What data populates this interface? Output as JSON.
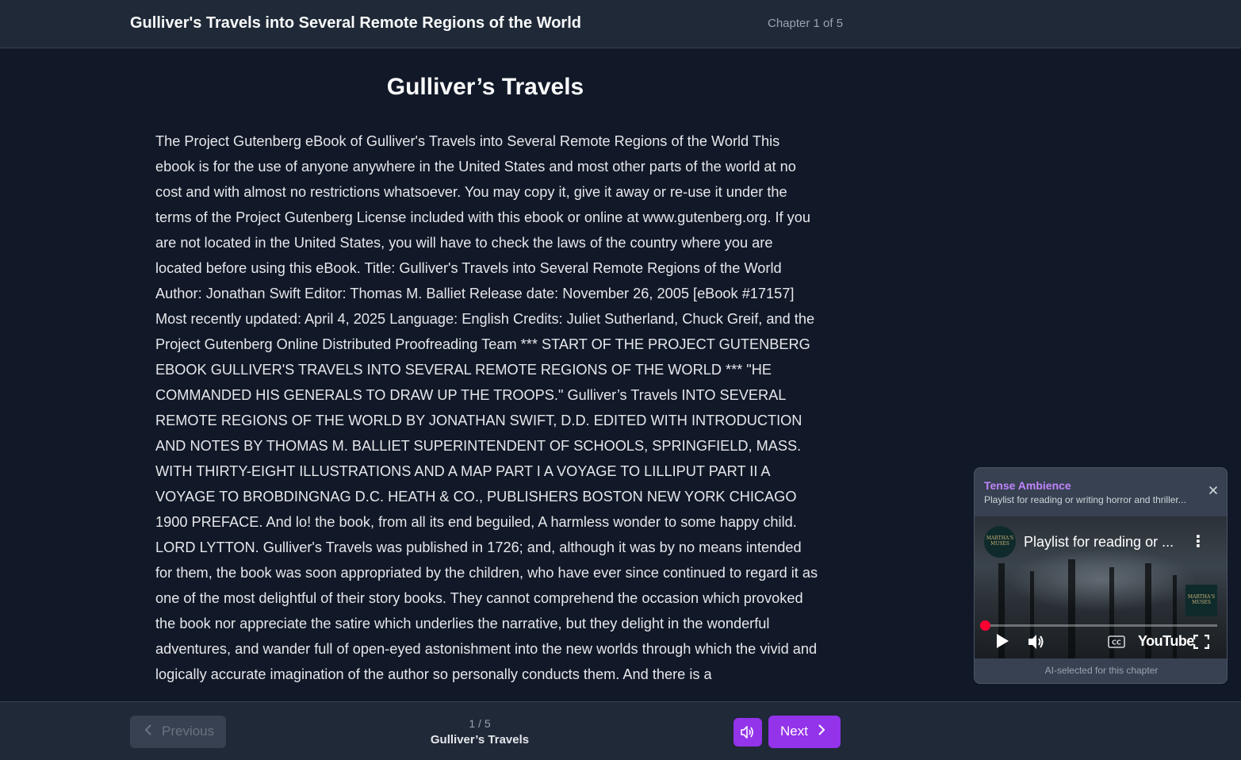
{
  "header": {
    "book_title": "Gulliver's Travels into Several Remote Regions of the World",
    "chapter_indicator": "Chapter 1 of 5"
  },
  "chapter": {
    "title": "Gulliver’s Travels",
    "body": "The Project Gutenberg eBook of Gulliver's Travels into Several Remote Regions of the World This ebook is for the use of anyone anywhere in the United States and most other parts of the world at no cost and with almost no restrictions whatsoever. You may copy it, give it away or re-use it under the terms of the Project Gutenberg License included with this ebook or online at www.gutenberg.org. If you are not located in the United States, you will have to check the laws of the country where you are located before using this eBook. Title: Gulliver's Travels into Several Remote Regions of the World Author: Jonathan Swift Editor: Thomas M. Balliet Release date: November 26, 2005 [eBook #17157] Most recently updated: April 4, 2025 Language: English Credits: Juliet Sutherland, Chuck Greif, and the Project Gutenberg Online Distributed Proofreading Team *** START OF THE PROJECT GUTENBERG EBOOK GULLIVER'S TRAVELS INTO SEVERAL REMOTE REGIONS OF THE WORLD *** \"HE COMMANDED HIS GENERALS TO DRAW UP THE TROOPS.\" Gulliver’s Travels INTO SEVERAL REMOTE REGIONS OF THE WORLD BY JONATHAN SWIFT, D.D. EDITED WITH INTRODUCTION AND NOTES BY THOMAS M. BALLIET SUPERINTENDENT OF SCHOOLS, SPRINGFIELD, MASS. WITH THIRTY-EIGHT ILLUSTRATIONS AND A MAP PART I A VOYAGE TO LILLIPUT PART II A VOYAGE TO BROBDINGNAG D.C. HEATH & CO., PUBLISHERS BOSTON NEW YORK CHICAGO 1900 PREFACE. And lo! the book, from all its end beguiled, A harmless wonder to some happy child. LORD LYTTON. Gulliver's Travels was published in 1726; and, although it was by no means intended for them, the book was soon appropriated by the children, who have ever since continued to regard it as one of the most delightful of their story books. They cannot comprehend the occasion which provoked the book nor appreciate the satire which underlies the narrative, but they delight in the wonderful adventures, and wander full of open-eyed astonishment into the new worlds through which the vivid and logically accurate imagination of the author so personally conducts them. And there is a"
  },
  "ambience": {
    "title": "Tense Ambience",
    "description": "Playlist for reading or writing horror and thriller...",
    "close_icon": "close-icon",
    "video": {
      "title": "Playlist for reading or ...",
      "channel_avatar_text": "MARTHA'S MUSES",
      "watermark_text": "MARTHA'S MUSES",
      "platform_logo": "YouTube",
      "progress_fraction": 0.0,
      "progress_color": "#ff0033"
    },
    "footer_note": "AI-selected for this chapter",
    "accent_color": "#c084fc"
  },
  "footer": {
    "prev_label": "Previous",
    "page_counter": "1 / 5",
    "chapter_name": "Gulliver’s Travels",
    "next_label": "Next",
    "accent_color": "#9333ea"
  }
}
